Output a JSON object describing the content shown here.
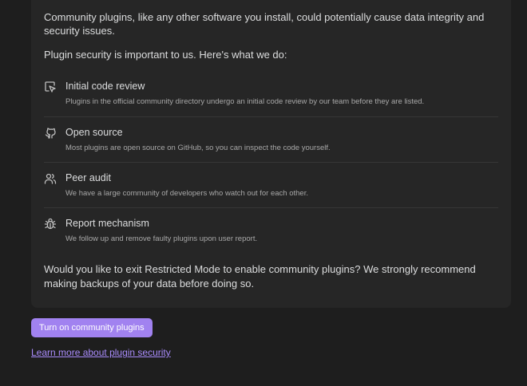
{
  "card": {
    "intro": "Community plugins, like any other software you install, could potentially cause data integrity and security issues.",
    "lead": "Plugin security is important to us. Here's what we do:",
    "items": [
      {
        "icon": "code-review-icon",
        "title": "Initial code review",
        "description": "Plugins in the official community directory undergo an initial code review by our team before they are listed."
      },
      {
        "icon": "github-icon",
        "title": "Open source",
        "description": "Most plugins are open source on GitHub, so you can inspect the code yourself."
      },
      {
        "icon": "users-icon",
        "title": "Peer audit",
        "description": "We have a large community of developers who watch out for each other."
      },
      {
        "icon": "bug-icon",
        "title": "Report mechanism",
        "description": "We follow up and remove faulty plugins upon user report."
      }
    ],
    "outro": "Would you like to exit Restricted Mode to enable community plugins? We strongly recommend making backups of your data before doing so."
  },
  "actions": {
    "turn_on_label": "Turn on community plugins",
    "learn_more_label": "Learn more about plugin security"
  },
  "colors": {
    "background": "#1e1e1e",
    "card": "#262626",
    "accent": "#a182f0",
    "link": "#a88bfa"
  }
}
